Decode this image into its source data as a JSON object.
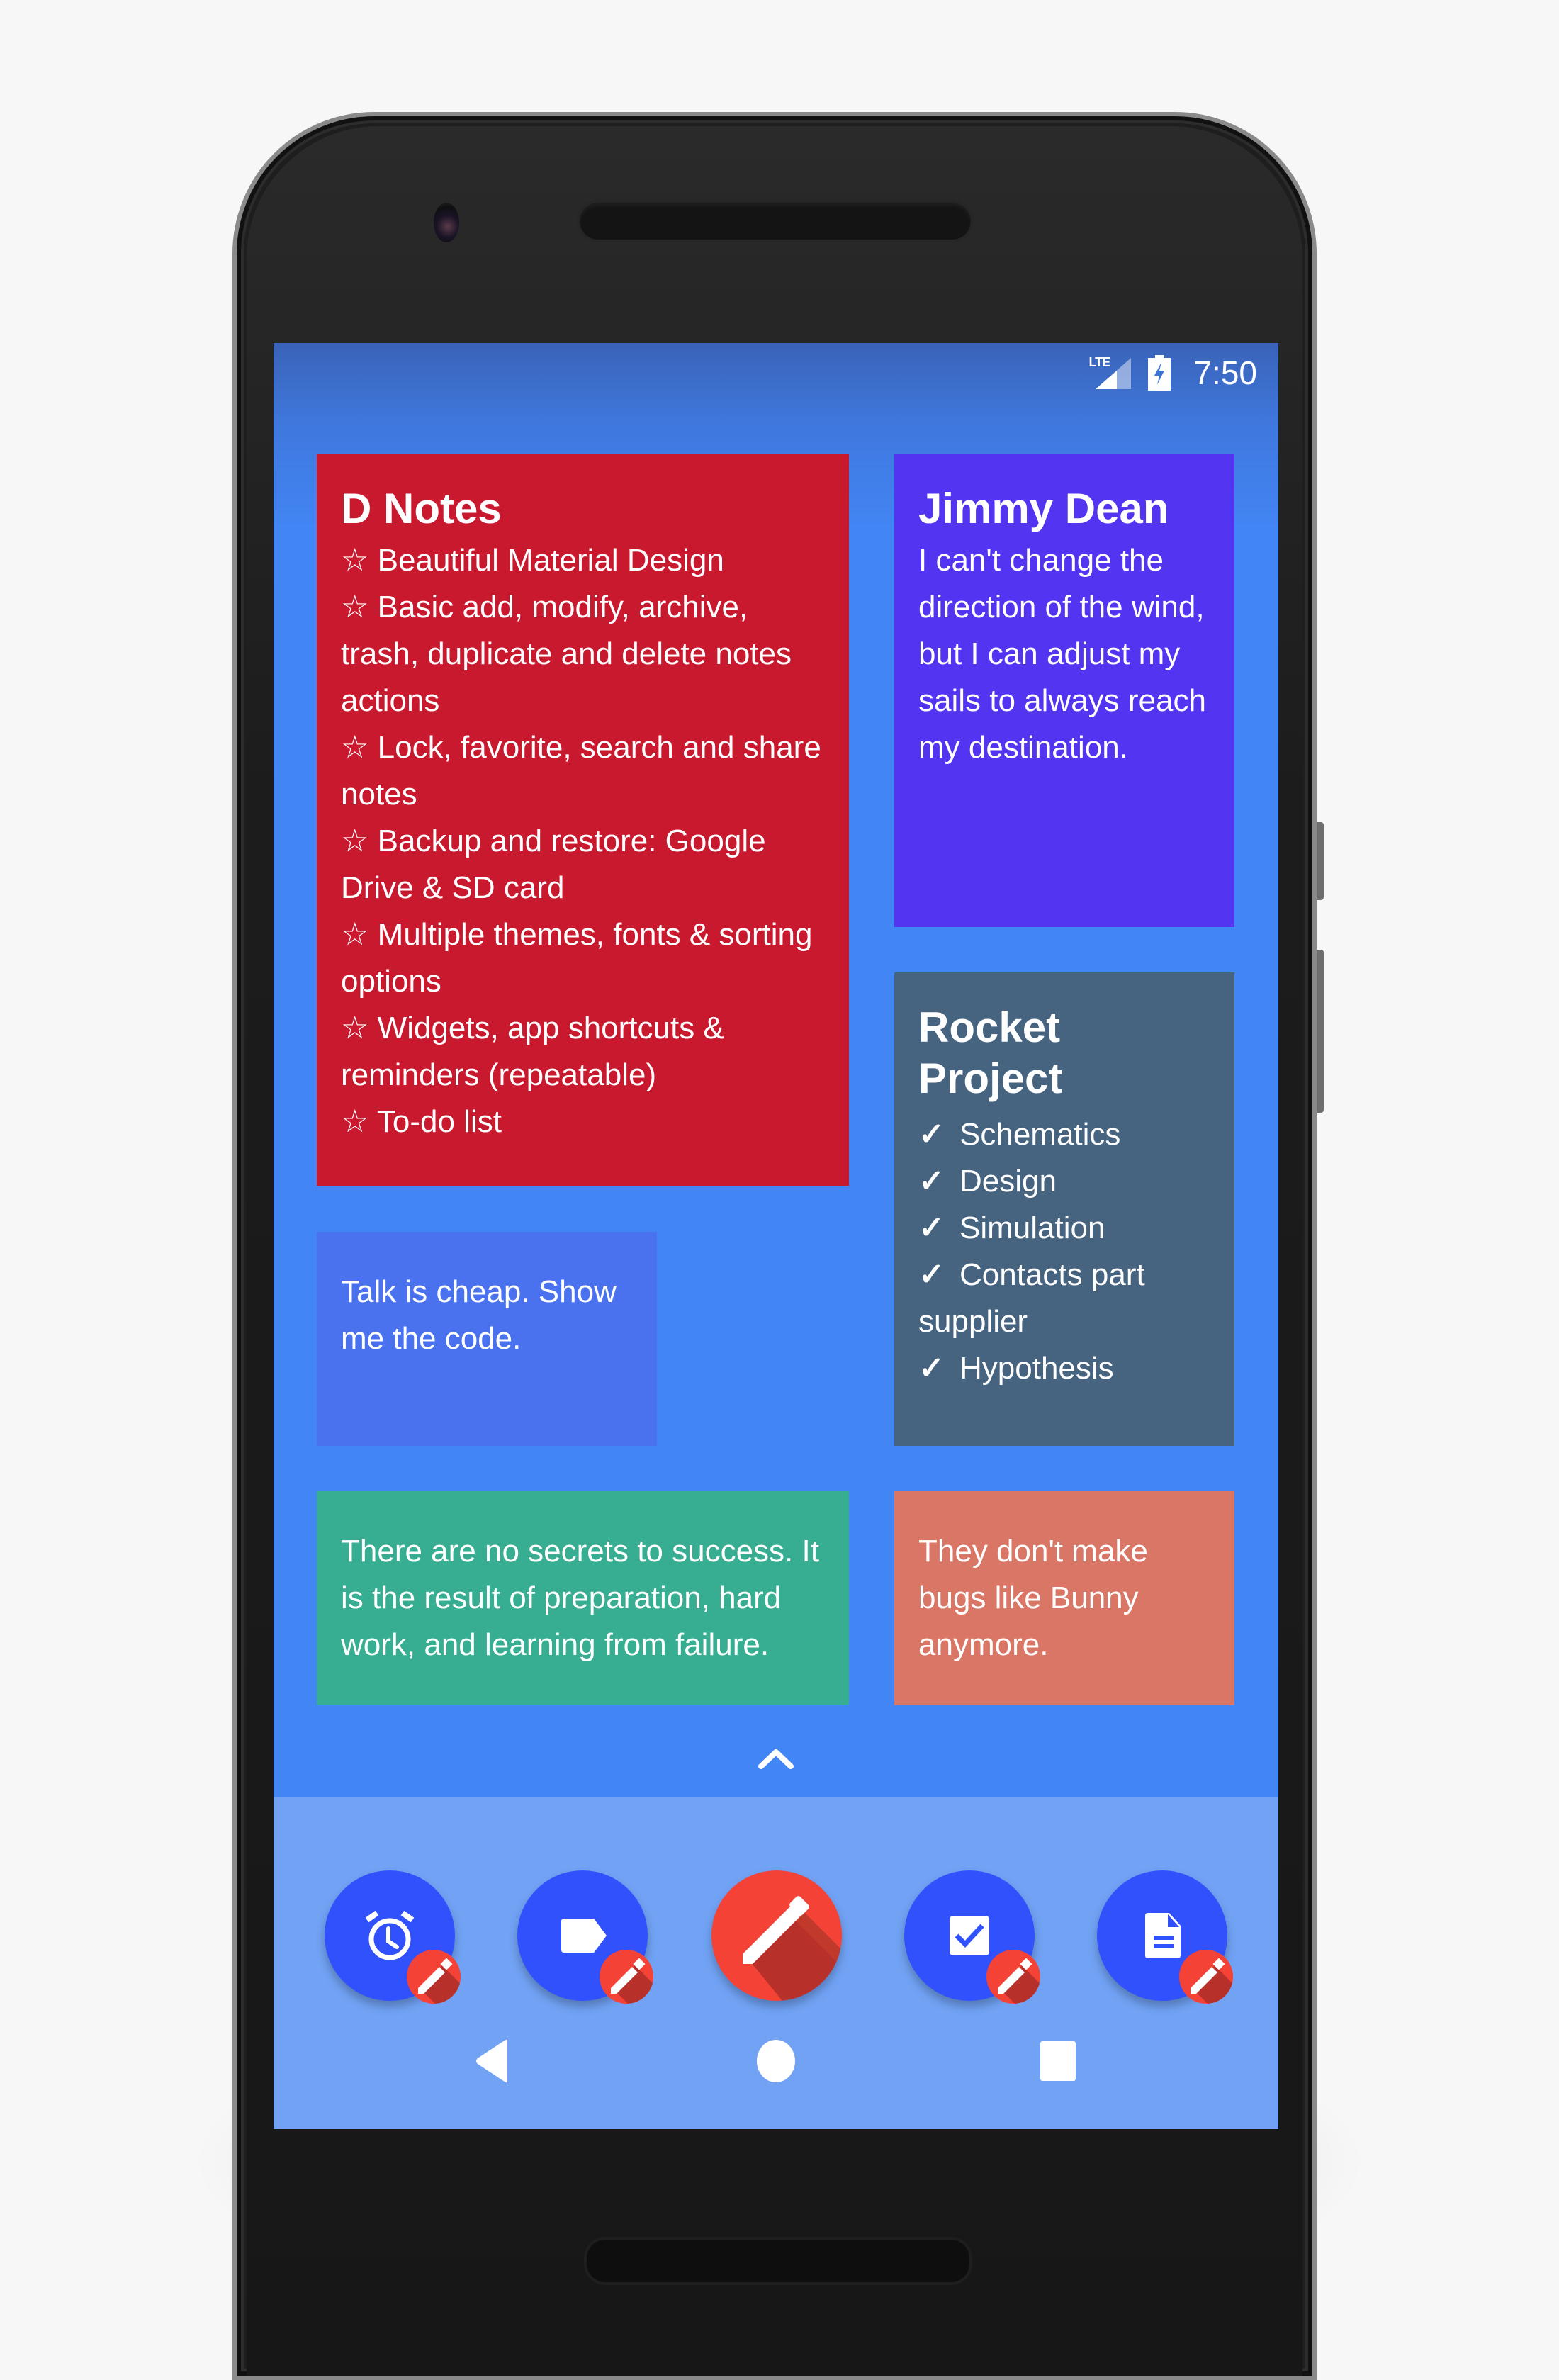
{
  "status_bar": {
    "network": "LTE",
    "network_icon": "signal-lte-icon",
    "battery_icon": "battery-charging-icon",
    "time": "7:50"
  },
  "notes": [
    {
      "id": "dnotes",
      "title": "D Notes",
      "color": "#c8192e",
      "bullet": "☆",
      "lines": [
        "☆ Beautiful Material Design",
        "☆ Basic add, modify, archive, trash, duplicate and delete notes actions",
        "☆ Lock, favorite, search and share notes",
        "☆ Backup and restore: Google Drive & SD card",
        "☆ Multiple themes, fonts & sorting options",
        "☆ Widgets, app shortcuts & reminders (repeatable)",
        "☆ To-do list"
      ]
    },
    {
      "id": "jimmy",
      "title": "Jimmy Dean",
      "color": "#5334f0",
      "body": "I can't change the direction of the wind, but I can adjust my sails to always reach my destination."
    },
    {
      "id": "rocket",
      "title": "Rocket Project",
      "color": "#466380",
      "checklist": [
        {
          "checked": true,
          "text": "Schematics"
        },
        {
          "checked": true,
          "text": "Design"
        },
        {
          "checked": true,
          "text": "Simulation"
        },
        {
          "checked": true,
          "text": "Contacts part supplier"
        },
        {
          "checked": true,
          "text": "Hypothesis"
        }
      ],
      "check_glyph": "✓"
    },
    {
      "id": "talk",
      "color": "#4a72ee",
      "body": "Talk is cheap. Show me the code."
    },
    {
      "id": "success",
      "color": "#37ad91",
      "body": "There are no secrets to success. It is the result of preparation, hard work, and learning from failure."
    },
    {
      "id": "bunny",
      "color": "#d97665",
      "body": "They don't make bugs like Bunny anymore."
    }
  ],
  "expand": {
    "icon": "chevron-up-icon"
  },
  "dock": {
    "color": "#71a2f4",
    "shortcuts": [
      {
        "name": "new-reminder-note",
        "icon": "alarm-icon",
        "badge": "pencil-icon"
      },
      {
        "name": "new-label-note",
        "icon": "label-icon",
        "badge": "pencil-icon"
      },
      {
        "name": "new-note",
        "icon": "pencil-icon",
        "main": true
      },
      {
        "name": "new-checklist-note",
        "icon": "checkbox-icon",
        "badge": "pencil-icon"
      },
      {
        "name": "new-text-note",
        "icon": "document-icon",
        "badge": "pencil-icon"
      }
    ]
  },
  "nav_bar": {
    "back": "back-icon",
    "home": "home-icon",
    "recents": "recents-icon"
  },
  "colors": {
    "screen_bg": "#4285f4",
    "fab_blue": "#3051fc",
    "fab_red": "#f44336"
  }
}
